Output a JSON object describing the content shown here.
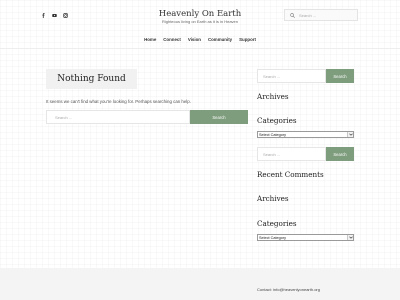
{
  "header": {
    "social_icons": [
      "facebook-icon",
      "youtube-icon",
      "instagram-icon"
    ],
    "site_title": "Heavenly On Earth",
    "tagline": "Righteous living on Earth as it is in Heaven",
    "search_placeholder": "Search ..."
  },
  "nav": {
    "items": [
      {
        "label": "Home"
      },
      {
        "label": "Connect"
      },
      {
        "label": "Vision"
      },
      {
        "label": "Community"
      },
      {
        "label": "Support"
      }
    ]
  },
  "main": {
    "page_title": "Nothing Found",
    "message": "It seems we can't find what you're looking for. Perhaps searching can help.",
    "search_placeholder": "Search ...",
    "search_button": "Search"
  },
  "sidebar": {
    "search1": {
      "placeholder": "Search ...",
      "button": "Search"
    },
    "archives1_title": "Archives",
    "categories1_title": "Categories",
    "categories1_selected": "Select Category",
    "search2": {
      "placeholder": "Search ...",
      "button": "Search"
    },
    "recent_comments_title": "Recent Comments",
    "archives2_title": "Archives",
    "categories2_title": "Categories",
    "categories2_selected": "Select Category"
  },
  "footer": {
    "contact": "Contact: info@heavenlyonearth.org"
  },
  "colors": {
    "accent": "#7e9d7d",
    "footer_bg": "#f4f4f4"
  }
}
